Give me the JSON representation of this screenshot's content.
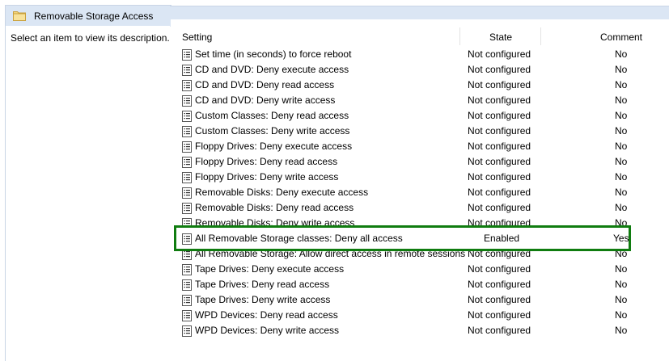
{
  "window": {
    "title": "Removable Storage Access"
  },
  "description_pane": {
    "text": "Select an item to view its description."
  },
  "columns": {
    "setting": "Setting",
    "state": "State",
    "comment": "Comment"
  },
  "colors": {
    "header_bg": "#dbe6f4",
    "highlight_border": "#107c10"
  },
  "rows": [
    {
      "setting": "Set time (in seconds) to force reboot",
      "state": "Not configured",
      "comment": "No"
    },
    {
      "setting": "CD and DVD: Deny execute access",
      "state": "Not configured",
      "comment": "No"
    },
    {
      "setting": "CD and DVD: Deny read access",
      "state": "Not configured",
      "comment": "No"
    },
    {
      "setting": "CD and DVD: Deny write access",
      "state": "Not configured",
      "comment": "No"
    },
    {
      "setting": "Custom Classes: Deny read access",
      "state": "Not configured",
      "comment": "No"
    },
    {
      "setting": "Custom Classes: Deny write access",
      "state": "Not configured",
      "comment": "No"
    },
    {
      "setting": "Floppy Drives: Deny execute access",
      "state": "Not configured",
      "comment": "No"
    },
    {
      "setting": "Floppy Drives: Deny read access",
      "state": "Not configured",
      "comment": "No"
    },
    {
      "setting": "Floppy Drives: Deny write access",
      "state": "Not configured",
      "comment": "No"
    },
    {
      "setting": "Removable Disks: Deny execute access",
      "state": "Not configured",
      "comment": "No"
    },
    {
      "setting": "Removable Disks: Deny read access",
      "state": "Not configured",
      "comment": "No"
    },
    {
      "setting": "Removable Disks: Deny write access",
      "state": "Not configured",
      "comment": "No"
    },
    {
      "setting": "All Removable Storage classes: Deny all access",
      "state": "Enabled",
      "comment": "Yes",
      "highlighted": true
    },
    {
      "setting": "All Removable Storage: Allow direct access in remote sessions",
      "state": "Not configured",
      "comment": "No"
    },
    {
      "setting": "Tape Drives: Deny execute access",
      "state": "Not configured",
      "comment": "No"
    },
    {
      "setting": "Tape Drives: Deny read access",
      "state": "Not configured",
      "comment": "No"
    },
    {
      "setting": "Tape Drives: Deny write access",
      "state": "Not configured",
      "comment": "No"
    },
    {
      "setting": "WPD Devices: Deny read access",
      "state": "Not configured",
      "comment": "No"
    },
    {
      "setting": "WPD Devices: Deny write access",
      "state": "Not configured",
      "comment": "No"
    }
  ]
}
